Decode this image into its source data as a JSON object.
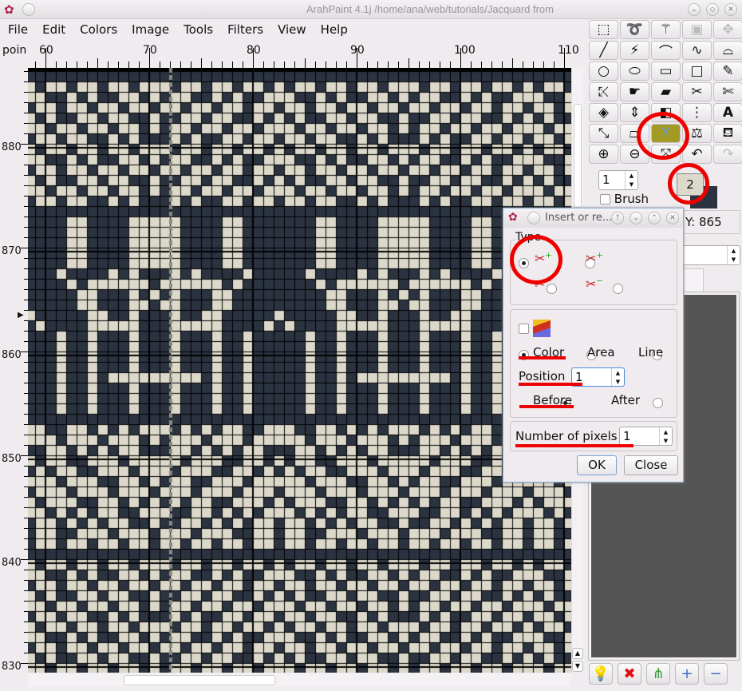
{
  "window": {
    "title": "ArahPaint 4.1j /home/ana/web/tutorials/Jacquard from"
  },
  "menu": [
    "File",
    "Edit",
    "Colors",
    "Image",
    "Tools",
    "Filters",
    "View",
    "Help"
  ],
  "ruler": {
    "unit_label": "poin",
    "top_labels": [
      "60",
      "70",
      "80",
      "90",
      "100",
      "110"
    ],
    "left_labels": [
      "880",
      "870",
      "860",
      "850",
      "840",
      "830"
    ]
  },
  "colors": {
    "dark": "#2b3340",
    "light": "#dcd9cb",
    "accent_red": "#e00000",
    "panel": "#555555"
  },
  "tools": [
    [
      "rect-select-icon",
      "lasso-icon",
      "magic-wand-icon",
      "crop-icon",
      "move-icon"
    ],
    [
      "line-icon",
      "polyline-icon",
      "curve-icon",
      "bezier-points-icon",
      "bezier-icon"
    ],
    [
      "circle-icon",
      "ellipse-icon",
      "rectangle-icon",
      "square-icon",
      "pencil-icon"
    ],
    [
      "pipette-icon",
      "smudge-icon",
      "eraser-icon",
      "cut-icon",
      "cut-side-icon"
    ],
    [
      "transform-icon",
      "flip-vertical-icon",
      "perspective-icon",
      "compress-icon",
      "text-icon"
    ],
    [
      "scale-icon",
      "skew-icon",
      "insert-remove-icon",
      "compass-icon",
      "fill-icon"
    ],
    [
      "zoom-in-icon",
      "zoom-out-icon",
      "expand-icon",
      "undo-icon",
      "redo-icon"
    ]
  ],
  "toolbox": {
    "size_value": "1",
    "brush_label": "Brush",
    "brush_checked": false,
    "fg_color_label": "2",
    "y_readout": "Y: 865"
  },
  "dialog": {
    "title": "Insert or re...",
    "type_label": "Type",
    "type_selected": "insert-vertical",
    "color_label": "Color",
    "area_label": "Area",
    "line_label": "Line",
    "mode_selected": "Color",
    "position_label": "Position",
    "position_value": "1",
    "before_label": "Before",
    "after_label": "After",
    "order_selected": "Before",
    "pixels_label": "Number of pixels",
    "pixels_value": "1",
    "ok_label": "OK",
    "close_label": "Close"
  },
  "bottom_buttons": [
    "bulb-icon",
    "delete-icon",
    "merge-icon",
    "add-icon",
    "remove-icon"
  ]
}
